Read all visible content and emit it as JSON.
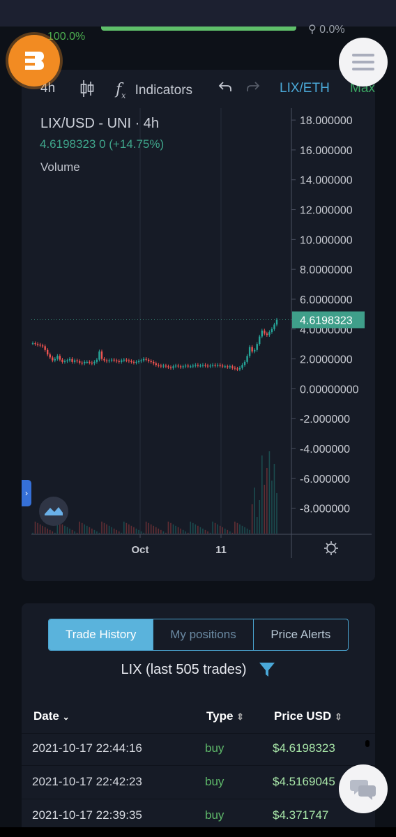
{
  "status": {
    "percent": "100.0%",
    "progress": 1.0,
    "right_value": "0.0%"
  },
  "toolbar": {
    "interval": "4h",
    "indicators": "Indicators",
    "pair_link": "LIX/ETH",
    "max": "Max"
  },
  "legend": {
    "title": "LIX/USD - UNI · 4h",
    "values": "4.6198323  0 (+14.75%)",
    "volume": "Volume"
  },
  "chart_data": {
    "type": "candlestick",
    "title": "LIX/USD - UNI · 4h",
    "y_ticks": [
      "18.000000",
      "16.000000",
      "14.000000",
      "12.000000",
      "10.000000",
      "8.0000000",
      "6.0000000",
      "4.0000000",
      "2.0000000",
      "0.00000000",
      "-2.000000",
      "-4.000000",
      "-6.000000",
      "-8.000000"
    ],
    "y_tick_values": [
      18,
      16,
      14,
      12,
      10,
      8,
      6,
      4,
      2,
      0,
      -2,
      -4,
      -6,
      -8
    ],
    "ylim": [
      -9.7,
      18.8
    ],
    "x_ticks": [
      "Oct",
      "11"
    ],
    "last_price_label": "4.6198323",
    "last_price": 4.6198323,
    "price_series": [
      3.05,
      3.0,
      2.95,
      2.9,
      2.85,
      2.6,
      2.3,
      2.1,
      1.9,
      2.0,
      2.2,
      1.95,
      1.8,
      1.85,
      1.9,
      2.0,
      1.8,
      1.9,
      1.85,
      1.75,
      1.7,
      1.8,
      1.8,
      1.75,
      1.7,
      1.8,
      1.95,
      2.5,
      2.0,
      1.9,
      1.85,
      1.9,
      1.95,
      1.9,
      1.85,
      1.8,
      1.9,
      1.95,
      1.9,
      1.85,
      1.8,
      1.75,
      1.8,
      1.85,
      1.9,
      2.0,
      1.95,
      1.85,
      1.8,
      1.7,
      1.6,
      1.55,
      1.5,
      1.55,
      1.5,
      1.45,
      1.4,
      1.5,
      1.55,
      1.5,
      1.45,
      1.5,
      1.55,
      1.5,
      1.5,
      1.55,
      1.6,
      1.55,
      1.55,
      1.6,
      1.55,
      1.5,
      1.55,
      1.6,
      1.55,
      1.6,
      1.55,
      1.5,
      1.5,
      1.45,
      1.5,
      1.4,
      1.35,
      1.3,
      1.4,
      1.6,
      1.8,
      2.2,
      2.8,
      2.5,
      2.6,
      3.0,
      3.5,
      3.9,
      3.7,
      3.6,
      3.8,
      4.0,
      4.3,
      4.62
    ]
  },
  "history": {
    "tabs": [
      "Trade History",
      "My positions",
      "Price Alerts"
    ],
    "active_tab": "Trade History",
    "title": "LIX (last 505 trades)",
    "columns": [
      "Date",
      "Type",
      "Price USD"
    ],
    "rows": [
      {
        "date": "2021-10-17 22:44:16",
        "type": "buy",
        "price": "$4.6198323"
      },
      {
        "date": "2021-10-17 22:42:23",
        "type": "buy",
        "price": "$4.5169045"
      },
      {
        "date": "2021-10-17 22:39:35",
        "type": "buy",
        "price": "$4.371747"
      }
    ]
  },
  "icons": {
    "logo": "brand-b-logo-icon",
    "menu": "hamburger-menu-icon",
    "candles": "candlestick-chart-icon",
    "fx": "function-fx-icon",
    "undo": "undo-arrow-icon",
    "redo": "redo-arrow-icon",
    "gear": "gear-icon",
    "filter": "filter-funnel-icon",
    "chat": "chat-bubbles-icon",
    "tradingview": "tradingview-logo-icon"
  },
  "colors": {
    "up": "#26a69a",
    "down": "#ef5350",
    "accent": "#5ab3dc",
    "price_tag": "#3f9f8a"
  }
}
